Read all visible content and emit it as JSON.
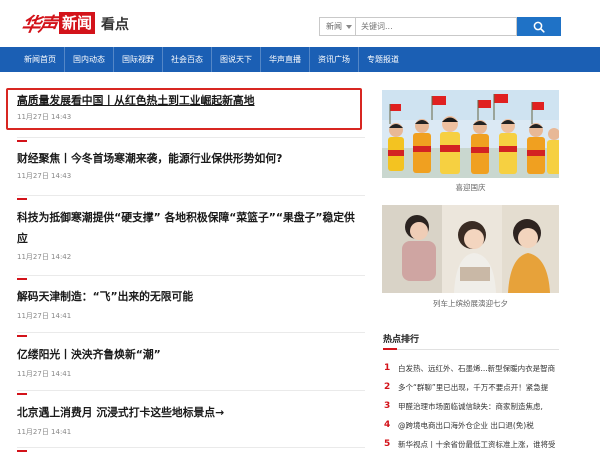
{
  "header": {
    "logo_script": "华声",
    "logo_box": "新闻",
    "section_title": "看点",
    "search": {
      "scope": "新闻",
      "placeholder": "关键词..."
    }
  },
  "nav": {
    "items": [
      "新闻首页",
      "国内动态",
      "国际视野",
      "社会百态",
      "图说天下",
      "华声直播",
      "资讯广场",
      "专题报道"
    ]
  },
  "articles": [
    {
      "title": "高质量发展看中国丨从红色热土到工业崛起新高地",
      "time": "11月27日 14:43"
    },
    {
      "title": "财经聚焦丨今冬首场寒潮来袭，能源行业保供形势如何?",
      "time": "11月27日 14:43"
    },
    {
      "title": "科技为抵御寒潮提供“硬支撑” 各地积极保障“菜篮子”“果盘子”稳定供应",
      "time": "11月27日 14:42"
    },
    {
      "title": "解码天津制造：“飞”出来的无限可能",
      "time": "11月27日 14:41"
    },
    {
      "title": "亿缕阳光丨泱泱齐鲁焕新“潮”",
      "time": "11月27日 14:41"
    },
    {
      "title": "北京遇上消费月 沉浸式打卡这些地标景点→",
      "time": "11月27日 14:41"
    }
  ],
  "photos": [
    {
      "caption": "喜迎国庆"
    },
    {
      "caption": "列车上缤纷展演迎七夕"
    }
  ],
  "hot": {
    "title": "热点排行",
    "items": [
      {
        "num": "1",
        "text": "白发热、远红外、石墨烯...新型保暖内衣是智商"
      },
      {
        "num": "2",
        "text": "多个“群聊”里已出现，千万不要点开！紧急提"
      },
      {
        "num": "3",
        "text": "甲醛治理市场面临诚信缺失：商家制造焦虑,"
      },
      {
        "num": "4",
        "text": "@跨境电商出口海外仓企业 出口退(免)税"
      },
      {
        "num": "5",
        "text": "新华视点丨十余省份最低工资标准上涨，谁将受"
      }
    ]
  },
  "colors": {
    "brand_red": "#d3131a",
    "nav_blue": "#1b5fb4",
    "search_blue": "#1f72c6"
  }
}
